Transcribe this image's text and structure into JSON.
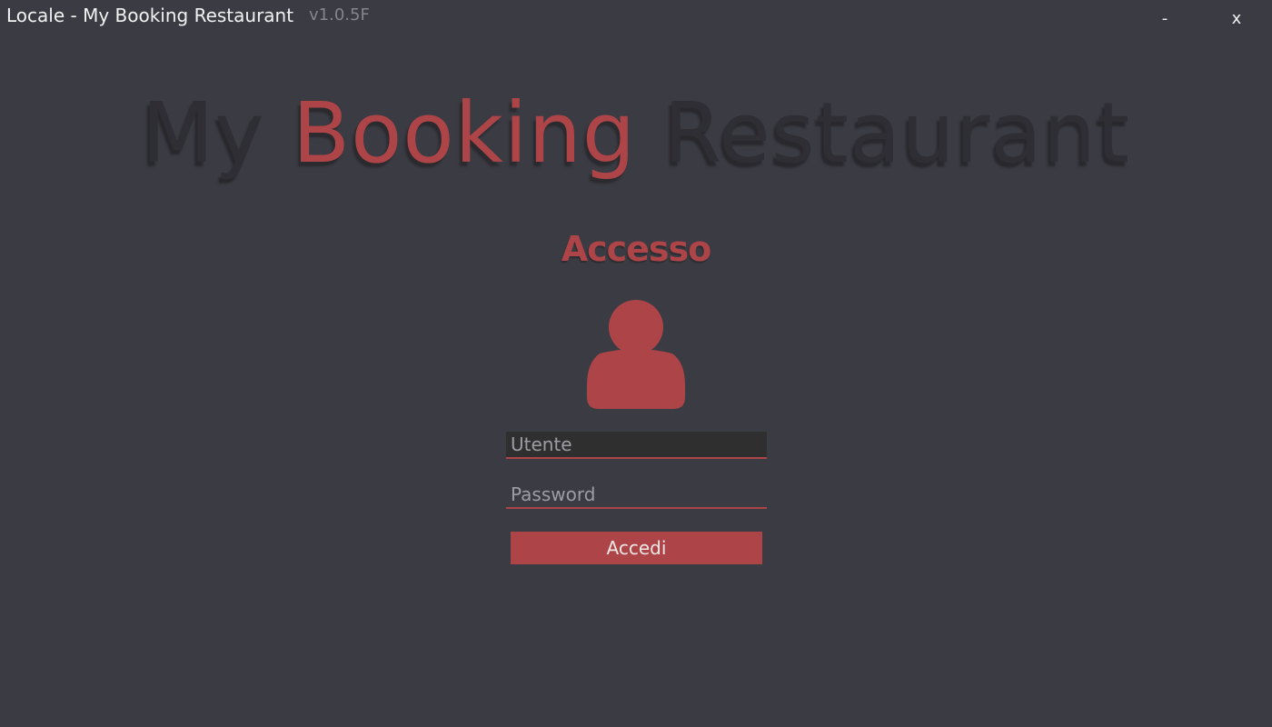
{
  "window": {
    "title": "Locale - My Booking Restaurant",
    "version": "v1.0.5F",
    "minimize_label": "-",
    "close_label": "x"
  },
  "brand": {
    "part1": "My",
    "part2": "Booking",
    "part3": "Restaurant"
  },
  "login": {
    "title": "Accesso",
    "user_icon": "user-icon",
    "username_placeholder": "Utente",
    "username_value": "",
    "password_placeholder": "Password",
    "password_value": "",
    "submit_label": "Accedi"
  },
  "colors": {
    "background": "#3b3b43",
    "accent": "#ad4548",
    "dark_text": "#2e2e34",
    "input_bg": "#2f2f30"
  }
}
